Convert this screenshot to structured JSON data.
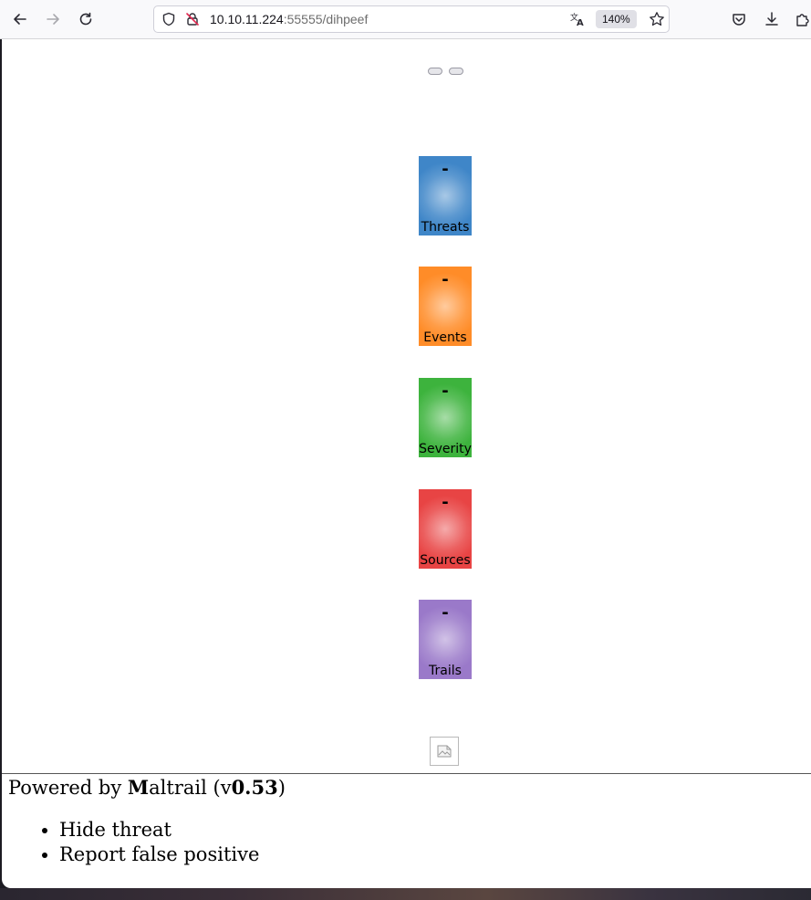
{
  "browser": {
    "url_host": "10.10.11.224",
    "url_rest": ":55555/dihpeef",
    "zoom": "140%"
  },
  "icons": {
    "back": "arrow-left-icon",
    "forward": "arrow-right-icon",
    "reload": "reload-icon",
    "shield": "shield-icon",
    "insecure": "insecure-lock-icon",
    "translate": "translate-icon",
    "bookmark": "star-icon",
    "pocket": "pocket-icon",
    "downloads": "download-icon",
    "extensions": "puzzle-icon",
    "broken_image": "broken-image-icon"
  },
  "stats": [
    {
      "label": "Threats",
      "value": "-",
      "color": "#3f86c8"
    },
    {
      "label": "Events",
      "value": "-",
      "color": "#ff8c28"
    },
    {
      "label": "Severity",
      "value": "-",
      "color": "#3db33d"
    },
    {
      "label": "Sources",
      "value": "-",
      "color": "#e84444"
    },
    {
      "label": "Trails",
      "value": "-",
      "color": "#9a79c9"
    }
  ],
  "footer": {
    "powered_prefix": "Powered by ",
    "brand_first": "M",
    "brand_rest": "altrail",
    "version_open": " (v",
    "version": "0.53",
    "version_close": ")"
  },
  "menu": [
    "Hide threat",
    "Report false positive"
  ]
}
